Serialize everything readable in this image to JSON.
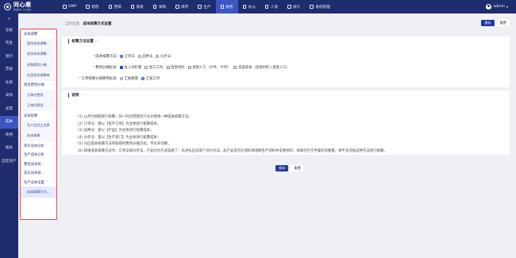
{
  "app": {
    "logo_name": "同心雁",
    "logo_sub": "数智制造 · 生产管理"
  },
  "topnav": {
    "items": [
      {
        "label": "GMP",
        "active": false
      },
      {
        "label": "销售",
        "active": false
      },
      {
        "label": "营销",
        "active": false
      },
      {
        "label": "研发",
        "active": false
      },
      {
        "label": "采购",
        "active": false
      },
      {
        "label": "库存",
        "active": false
      },
      {
        "label": "生产",
        "active": false
      },
      {
        "label": "财务",
        "active": true
      },
      {
        "label": "办公",
        "active": false
      },
      {
        "label": "人资",
        "active": false
      },
      {
        "label": "统计",
        "active": false
      },
      {
        "label": "系统管理",
        "active": false
      }
    ],
    "user": "admin",
    "user_caret": "▾"
  },
  "modules": {
    "search_icon": "⌕",
    "items": [
      {
        "label": "总账",
        "active": false
      },
      {
        "label": "现金",
        "active": false
      },
      {
        "label": "银行",
        "active": false
      },
      {
        "label": "票据",
        "active": false
      },
      {
        "label": "往来",
        "active": false
      },
      {
        "label": "采购",
        "active": false
      },
      {
        "label": "发票",
        "active": false
      },
      {
        "label": "成本",
        "active": true
      },
      {
        "label": "费用",
        "active": false
      },
      {
        "label": "报表",
        "active": false
      },
      {
        "label": "固定资产",
        "active": false
      }
    ]
  },
  "submenu": {
    "entries": [
      {
        "type": "group",
        "label": "成本调整",
        "chev": "^"
      },
      {
        "type": "item",
        "label": "暂估成本调整...",
        "active": false
      },
      {
        "type": "item",
        "label": "差异成本调整...",
        "active": false
      },
      {
        "type": "item",
        "label": "采购费用分摊...",
        "active": false
      },
      {
        "type": "item",
        "label": "红蓝成本调整单",
        "active": false
      },
      {
        "type": "group",
        "label": "制造费用分摊",
        "chev": "^"
      },
      {
        "type": "item",
        "label": "订单内费用",
        "active": false
      },
      {
        "type": "item",
        "label": "订单间费用",
        "active": false
      },
      {
        "type": "group",
        "label": "成本核算",
        "chev": "^"
      },
      {
        "type": "item",
        "label": "生产品完工还原",
        "active": false
      },
      {
        "type": "item",
        "label": "成本核算",
        "active": false
      },
      {
        "type": "group",
        "label": "库存成本分析",
        "chev": "⌄"
      },
      {
        "type": "group",
        "label": "生产成本分析",
        "chev": "⌄"
      },
      {
        "type": "group",
        "label": "整批成本调...",
        "chev": "⌄"
      },
      {
        "type": "group",
        "label": "差异成本调...",
        "chev": "⌄"
      },
      {
        "type": "group",
        "label": "生产成本设置",
        "chev": "^"
      },
      {
        "type": "item",
        "label": "成本核算方式...",
        "active": true
      }
    ]
  },
  "breadcrumb": {
    "label": "当前位置:",
    "title": "成本核算方式设置"
  },
  "header_actions": {
    "save": "保存",
    "reset": "重置"
  },
  "settings": {
    "section_title": "核算方法设置",
    "section_chev": "^",
    "calc_method": {
      "label": "成本核算方法:",
      "required": "*",
      "options": [
        {
          "label": "订单法",
          "checked": true
        },
        {
          "label": "品种法",
          "checked": false
        },
        {
          "label": "分步法",
          "checked": false
        }
      ]
    },
    "allocation": {
      "label": "费用分摊标准:",
      "required": "*",
      "options": [
        {
          "label": "投入领料量",
          "checked": true
        },
        {
          "label": "加工工时",
          "checked": false
        },
        {
          "label": "直接材料",
          "checked": false
        },
        {
          "label": "直接人工（计件、计时）",
          "checked": false
        },
        {
          "label": "直接成本（直接材料+直接人工）",
          "checked": false
        }
      ]
    },
    "hours_basis": {
      "label": "工序核算分摊费用标准:",
      "required": "*",
      "options": [
        {
          "label": "汇报数量",
          "checked": false
        },
        {
          "label": "汇报工时",
          "checked": true
        }
      ]
    }
  },
  "notes": {
    "section_title": "说明",
    "section_chev": "^",
    "lines": [
      "(1) 以月为周期进行核算，同一时间范围内只允许使用一种成本核算方法；",
      "(2) 订单法：基以【生产订单】为主体进行核算成本；",
      "(3) 品种法：基以【产品】为主体进行核算成本；",
      "(4) 分步法：基以【生产部门】为主体进行核算成本；",
      "(5) 对应成本核算方法所获取的费用分摊方式，不允许切换；",
      "(6) 如果成本核算方式为：订单法和分步法，产品计价方式选择了：先进先出法或个别计价法，此产品支持在领料请领和生产领料中支撑领料，如果存在空手操作的数量，将不支持按这种方法进行核算。"
    ]
  },
  "footer": {
    "save": "保存",
    "reset": "重置"
  },
  "colors": {
    "nav_bg": "#1f2d6e",
    "accent": "#3e56c4",
    "primary_btn": "#1f3a9e",
    "highlight_border": "#e8434b"
  }
}
